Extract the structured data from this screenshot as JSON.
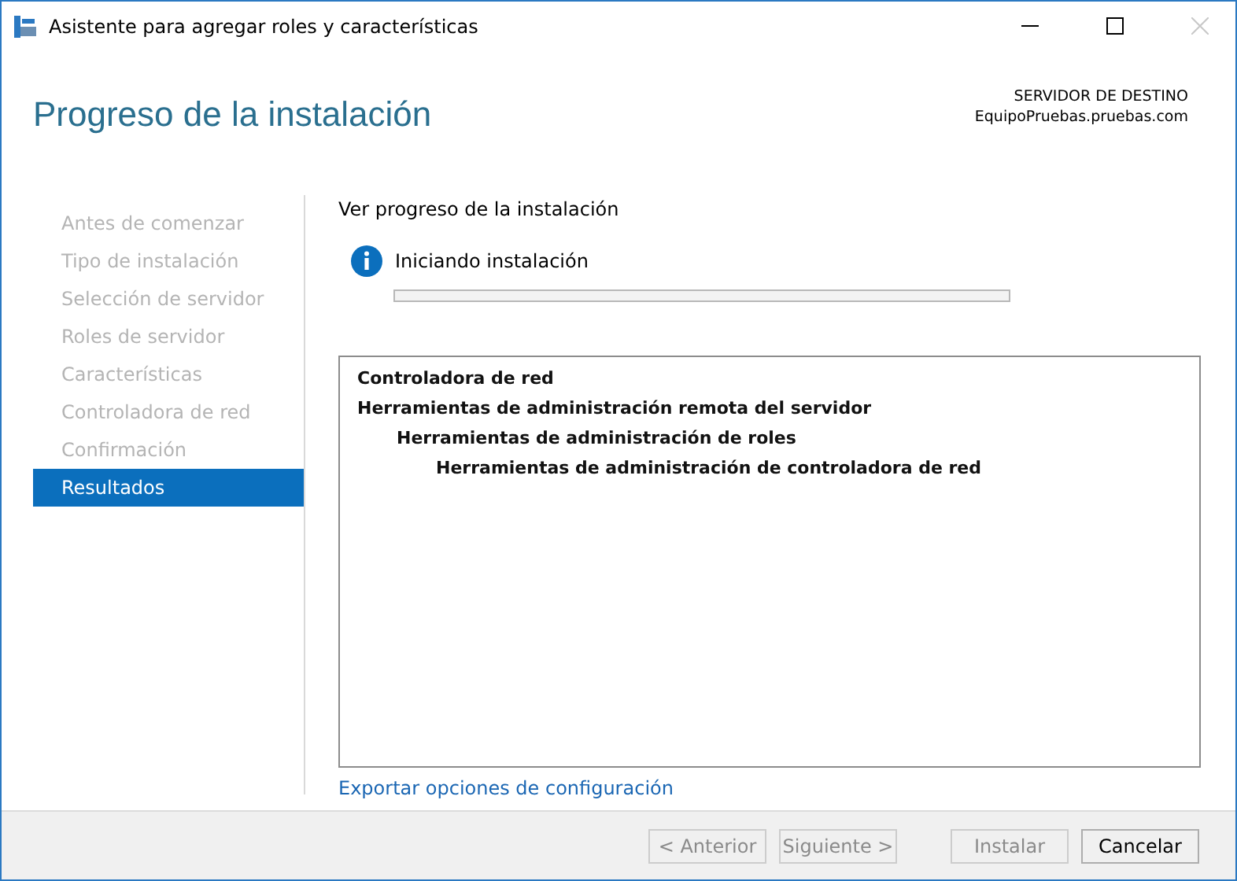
{
  "window": {
    "title": "Asistente para agregar roles y características",
    "close_disabled": true
  },
  "header": {
    "title": "Progreso de la instalación",
    "server_label": "SERVIDOR DE DESTINO",
    "server_name": "EquipoPruebas.pruebas.com"
  },
  "sidebar": {
    "items": [
      {
        "label": "Antes de comenzar",
        "selected": false
      },
      {
        "label": "Tipo de instalación",
        "selected": false
      },
      {
        "label": "Selección de servidor",
        "selected": false
      },
      {
        "label": "Roles de servidor",
        "selected": false
      },
      {
        "label": "Características",
        "selected": false
      },
      {
        "label": "Controladora de red",
        "selected": false
      },
      {
        "label": "Confirmación",
        "selected": false
      },
      {
        "label": "Resultados",
        "selected": true
      }
    ]
  },
  "content": {
    "heading": "Ver progreso de la instalación",
    "status": "Iniciando instalación",
    "progress": {
      "level": 0
    },
    "features": [
      {
        "label": "Controladora de red"
      },
      {
        "label": "Herramientas de administración remota del servidor",
        "children": [
          {
            "label": "Herramientas de administración de roles",
            "children": [
              {
                "label": "Herramientas de administración de controladora de red"
              }
            ]
          }
        ]
      }
    ],
    "export_link": "Exportar opciones de configuración"
  },
  "buttons": [
    {
      "label": "< Anterior",
      "disabled": true
    },
    {
      "label": "Siguiente >",
      "disabled": true
    },
    {
      "label": "Instalar",
      "disabled": true
    },
    {
      "label": "Cancelar",
      "disabled": false
    }
  ]
}
